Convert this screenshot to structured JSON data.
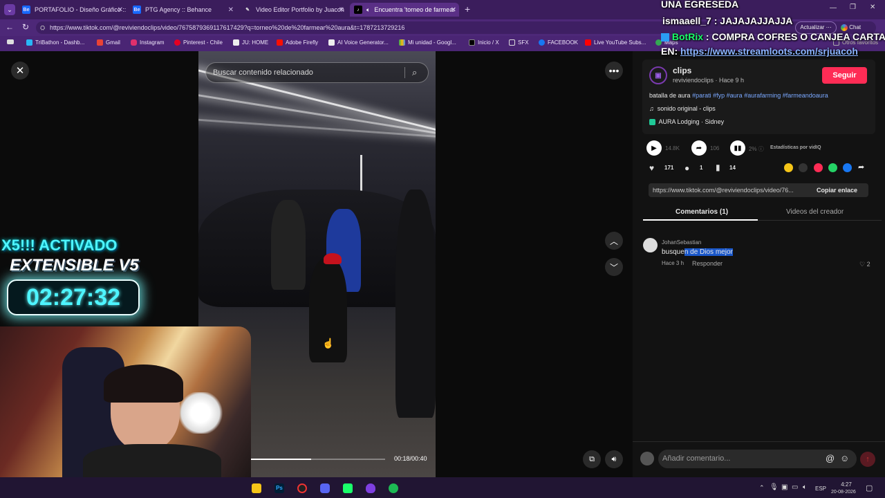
{
  "tabs": [
    {
      "label": "PORTAFOLIO - Diseño Gráfico :: Be",
      "icon": "behance-icon",
      "active": false
    },
    {
      "label": "PTG Agency :: Behance",
      "icon": "behance-icon",
      "active": false
    },
    {
      "label": "Video Editor Portfolio by Juacoh",
      "icon": "pen-icon",
      "active": false
    },
    {
      "label": "Encuentra 'torneo de farmear",
      "icon": "tiktok-icon",
      "active": true
    }
  ],
  "url": "https://www.tiktok.com/@reviviendoclips/video/7675879369117617429?q=torneo%20de%20farmear%20aura&t=1787213729216",
  "bookmarks": [
    "TriBathon - Dashb...",
    "Gmail",
    "Instagram",
    "Pinterest - Chile",
    "JU: HOME",
    "Adobe Firefly",
    "AI Voice Generator...",
    "Mi unidad - Googl...",
    "Inicio / X",
    "SFX",
    "FACEBOOK",
    "Live YouTube Subs...",
    "Maps"
  ],
  "bookmarks_right": "Otros favoritos",
  "browser_buttons": {
    "update": "Actualizar",
    "chat": "Chat"
  },
  "search": {
    "placeholder": "Buscar contenido relacionado"
  },
  "video": {
    "time": "00:18/00:40",
    "progress": 0.45
  },
  "author": {
    "name": "clips",
    "handle": "reviviendoclips",
    "time": "Hace 9 h",
    "follow": "Seguir"
  },
  "description": {
    "text": "batalla de aura",
    "hashtags": [
      "#parati",
      "#fyp",
      "#aura",
      "#aurafarming",
      "#farmeandoaura"
    ],
    "sound": "sonido original - clips",
    "location": "AURA Lodging · Sidney"
  },
  "stats": {
    "plays": "14.8K",
    "shares": "106",
    "percent": "2%",
    "vidiq": "Estadísticas por vidIQ",
    "likes": "171",
    "comments": "1",
    "saves": "14"
  },
  "share_icons": [
    "coin-icon",
    "embed-icon",
    "send-icon",
    "whatsapp-icon",
    "facebook-icon",
    "share-arrow-icon"
  ],
  "copy": {
    "url": "https://www.tiktok.com/@reviviendoclips/video/76...",
    "button": "Copiar enlace"
  },
  "panel_tabs": {
    "comments": "Comentarios (1)",
    "creator": "Videos del creador"
  },
  "comment": {
    "user": "JohanSebastian",
    "text_a": "busque",
    "text_b": "n de Dios mejor",
    "time": "Hace 3 h",
    "reply": "Responder",
    "likes": "2"
  },
  "comment_input": {
    "placeholder": "Añadir comentario..."
  },
  "overlay": {
    "chat": [
      {
        "user": "",
        "text": "UNA EGRESEDA"
      },
      {
        "user": "ismaaell_7",
        "text": ": JAJAJAJJAJJA"
      },
      {
        "user": "BotRix",
        "text": ": COMPRA COFRES O CANJEA CARTAS"
      },
      {
        "user": "EN:",
        "text": "https://www.streamloots.com/srjuacoh"
      }
    ],
    "promo_line1": "X5!!! ACTIVADO",
    "promo_line2": "EXTENSIBLE V5",
    "timer": "02:27:32"
  },
  "taskbar": {
    "lang": "ESP",
    "time": "4:27",
    "date": "20-08-2026"
  },
  "colors": {
    "accent": "#fe2c55",
    "browser": "#4d2878",
    "link": "#7aa8ff",
    "timer": "#4ef5ff"
  }
}
